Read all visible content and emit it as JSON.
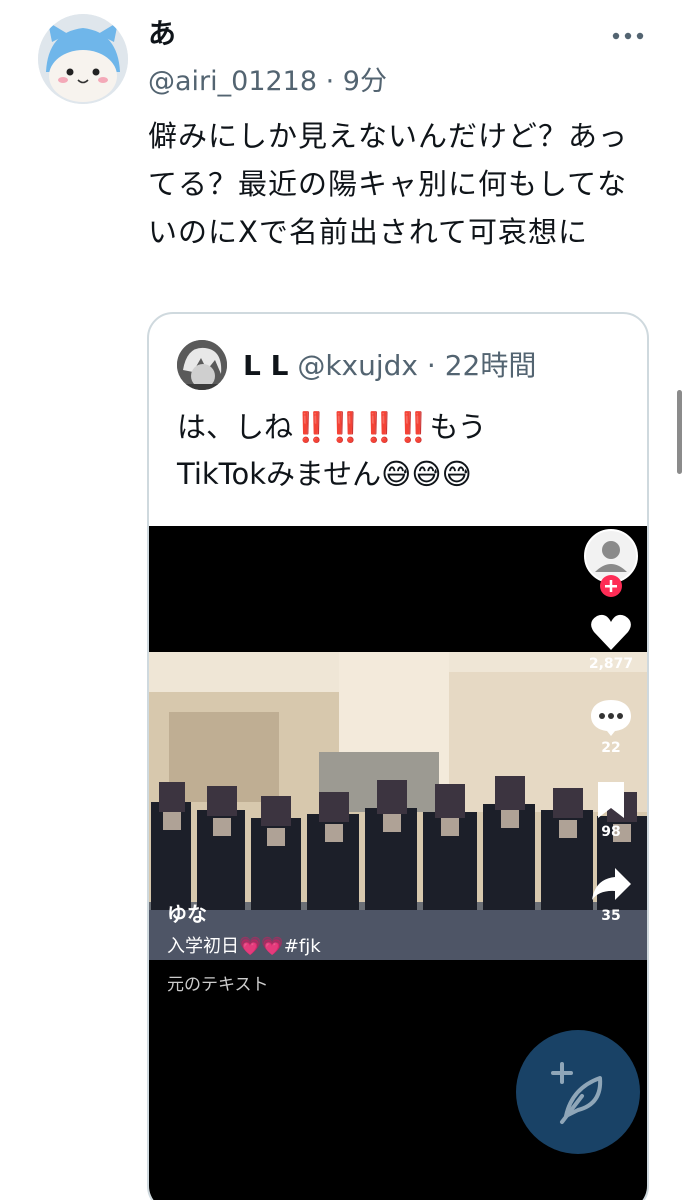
{
  "tweet": {
    "display_name": "あ",
    "handle": "@airi_01218",
    "separator": " · ",
    "time": "9分",
    "text": "僻みにしか見えないんだけど？あってる？最近の陽キャ別に何もしてないのにXで名前出されて可哀想に"
  },
  "quote": {
    "display_name": "L L",
    "handle": "@kxujdx",
    "separator": " · ",
    "time": "22時間",
    "text_part1": "は、しね",
    "bangs": "‼️‼️‼️‼️",
    "text_part2": "もう",
    "text_line2": "TikTokみません",
    "emojis": "😅😅😅"
  },
  "video": {
    "likes": "2,877",
    "comments": "22",
    "bookmarks": "98",
    "shares": "35",
    "username": "ゆな",
    "caption": "入学初日💗💗#fjk",
    "subcaption": "元のテキスト"
  },
  "colors": {
    "text": "#0f1419",
    "secondary": "#536471",
    "border": "#cfd9de",
    "fab": "#1d4e78",
    "bang": "#d21f3c"
  },
  "icons": [
    "more-icon",
    "tiktok-profile-icon",
    "follow-plus-icon",
    "heart-icon",
    "comment-icon",
    "bookmark-icon",
    "share-icon",
    "compose-icon"
  ]
}
